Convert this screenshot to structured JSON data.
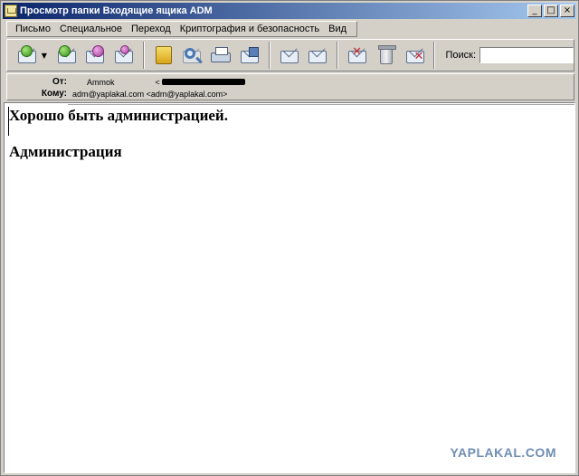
{
  "window": {
    "title": "Просмотр папки Входящие ящика ADM",
    "controls": [
      "_",
      "□",
      "×"
    ]
  },
  "menu": [
    "Письмо",
    "Специальное",
    "Переход",
    "Криптография и безопасность",
    "Вид"
  ],
  "toolbar": {
    "buttons": [
      {
        "icon": "get-mail-icon"
      },
      {
        "icon": "reply-all-icon"
      },
      {
        "icon": "forward-icon"
      },
      {
        "icon": "new-message-icon"
      },
      {
        "icon": "address-book-icon"
      },
      {
        "icon": "find-icon"
      },
      {
        "icon": "print-icon"
      },
      {
        "icon": "save-icon"
      },
      {
        "icon": "previous-icon"
      },
      {
        "icon": "next-icon"
      },
      {
        "icon": "delete-message-icon"
      },
      {
        "icon": "trash-icon"
      },
      {
        "icon": "junk-icon"
      }
    ],
    "search_label": "Поиск:",
    "search_value": ""
  },
  "headers": {
    "from_label": "От:",
    "from_value": "Ammok",
    "from_addr_open": "<",
    "to_label": "Кому:",
    "to_value": "adm@yaplakal.com <adm@yaplakal.com>"
  },
  "message": {
    "line1": "Хорошо быть администрацией.",
    "line2": "Администрация"
  },
  "watermark": "YAPLAKAL.COM"
}
